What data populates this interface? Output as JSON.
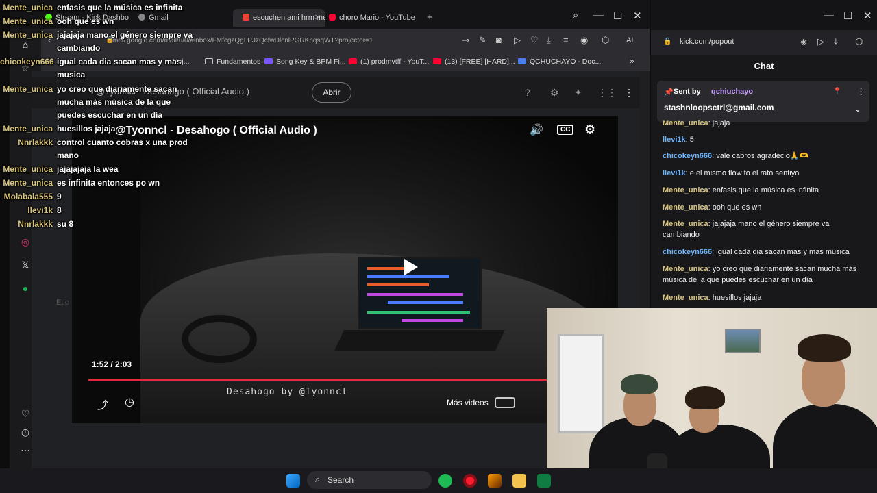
{
  "browser": {
    "tabs": [
      {
        "label": "Stream - Kick Dashbo"
      },
      {
        "label": "Gmail"
      },
      {
        "label": "escuchen ami hrm me"
      },
      {
        "label": "choro Mario - YouTube"
      }
    ],
    "url": "mail.google.com/mail/u/0/#inbox/FMfcgzQgLPJzQcfwDlcnlPGRKnqsqWT?projector=1",
    "ai_label": "AI",
    "bookmarks": [
      {
        "label": "Hoj..."
      },
      {
        "label": "Fundamentos"
      },
      {
        "label": "Song Key & BPM Fi..."
      },
      {
        "label": "(1) prodmvtff - YouT..."
      },
      {
        "label": "(13) [FREE] [HARD]..."
      },
      {
        "label": "QCHUCHAYO - Doc..."
      }
    ],
    "header_title": "@Tyonncl - Desahogo ( Official Audio )",
    "abrir_label": "Abrir",
    "etc_label": "Etic"
  },
  "video": {
    "title": "@Tyonncl - Desahogo ( Official Audio )",
    "time": "1:52 / 2:03",
    "progress": 0.91,
    "watermark": "Desahogo by @Tyonncl",
    "mas_videos": "Más videos",
    "cc_label": "CC"
  },
  "overlay_chat": [
    {
      "user": "Mente_unica",
      "msg": "enfasis que la música es infinita"
    },
    {
      "user": "Mente_unica",
      "msg": "ooh que es wn"
    },
    {
      "user": "Mente_unica",
      "msg": "jajajaja mano el género siempre va"
    },
    {
      "user": "",
      "msg": "cambiando"
    },
    {
      "user": "chicokeyn666",
      "msg": "igual cada dia sacan mas y mas"
    },
    {
      "user": "",
      "msg": "musica"
    },
    {
      "user": "Mente_unica",
      "msg": "yo creo que diariamente sacan"
    },
    {
      "user": "",
      "msg": "mucha más música de la que"
    },
    {
      "user": "",
      "msg": "puedes escuchar en un día"
    },
    {
      "user": "Mente_unica",
      "msg": "huesillos jajaja"
    },
    {
      "user": "Nnrlakkk",
      "msg": "control cuanto cobras x una prod"
    },
    {
      "user": "",
      "msg": "mano"
    },
    {
      "user": "Mente_unica",
      "msg": "jajajajaja la wea"
    },
    {
      "user": "Mente_unica",
      "msg": "es infinita entonces po wn"
    },
    {
      "user": "Molabala555",
      "msg": "9"
    },
    {
      "user": "llevi1k",
      "msg": "8"
    },
    {
      "user": "Nnrlakkk",
      "msg": "su 8"
    }
  ],
  "kick": {
    "url": "kick.com/popout",
    "chat_title": "Chat",
    "pinned": {
      "sent_by": "Sent by",
      "user": "qchiuchayo",
      "msg": "stashnloopsctrl@gmail.com"
    },
    "messages": [
      {
        "user": "Mente_unica",
        "msg": "jajaja",
        "color": "#d7c47a"
      },
      {
        "user": "llevi1k",
        "msg": "5",
        "color": "#6bb6ff"
      },
      {
        "user": "chicokeyn666",
        "msg": "vale cabros agradecio🙏🫶",
        "color": "#6bb6ff"
      },
      {
        "user": "llevi1k",
        "msg": "e el mismo flow to el rato sentiyo",
        "color": "#6bb6ff"
      },
      {
        "user": "Mente_unica",
        "msg": "enfasis que la música es infinita",
        "color": "#d7c47a"
      },
      {
        "user": "Mente_unica",
        "msg": "ooh que es wn",
        "color": "#d7c47a"
      },
      {
        "user": "Mente_unica",
        "msg": "jajajaja mano el género siempre va cambiando",
        "color": "#d7c47a"
      },
      {
        "user": "chicokeyn666",
        "msg": "igual cada dia sacan mas y mas musica",
        "color": "#6bb6ff"
      },
      {
        "user": "Mente_unica",
        "msg": "yo creo que diariamente sacan mucha más música de la que puedes escuchar en un día",
        "color": "#d7c47a"
      },
      {
        "user": "Mente_unica",
        "msg": "huesillos jajaja",
        "color": "#d7c47a"
      }
    ]
  },
  "taskbar": {
    "search_label": "Search"
  }
}
